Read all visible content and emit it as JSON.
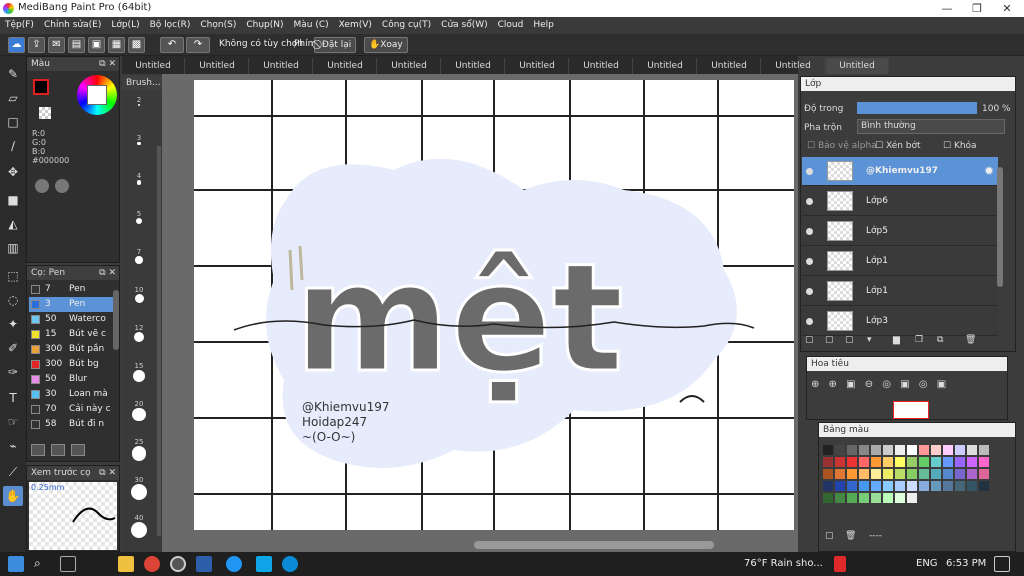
{
  "window": {
    "title": "MediBang Paint Pro (64bit)",
    "min": "—",
    "max": "❐",
    "close": "✕"
  },
  "menu": [
    "Tệp(F)",
    "Chỉnh sửa(E)",
    "Lớp(L)",
    "Bộ lọc(R)",
    "Chọn(S)",
    "Chụp(N)",
    "Màu (C)",
    "Xem(V)",
    "Công cụ(T)",
    "Cửa sổ(W)",
    "Cloud",
    "Help"
  ],
  "toolbar": {
    "no_options": "Không có tùy chọn",
    "key_label": "Phím",
    "reset_label": "Đặt lại",
    "rotate_label": "Xoay"
  },
  "tabs": [
    "Untitled",
    "Untitled",
    "Untitled",
    "Untitled",
    "Untitled",
    "Untitled",
    "Untitled",
    "Untitled",
    "Untitled",
    "Untitled",
    "Untitled",
    "Untitled"
  ],
  "color_panel": {
    "title": "Màu",
    "r": "R:0",
    "g": "G:0",
    "b": "B:0",
    "hex": "#000000"
  },
  "brush_panel": {
    "title": "Cọ: Pen",
    "items": [
      {
        "size": "7",
        "name": "Pen",
        "color": "#333333"
      },
      {
        "size": "3",
        "name": "Pen",
        "color": "#2a6fdc"
      },
      {
        "size": "50",
        "name": "Waterco",
        "color": "#6ec6f0"
      },
      {
        "size": "15",
        "name": "Bút vẽ c",
        "color": "#f2e12a"
      },
      {
        "size": "300",
        "name": "Bút pần",
        "color": "#e9a23b"
      },
      {
        "size": "300",
        "name": "Bút bg",
        "color": "#e02626"
      },
      {
        "size": "50",
        "name": "Blur",
        "color": "#e88ee8"
      },
      {
        "size": "30",
        "name": "Loan mà",
        "color": "#58c0f0"
      },
      {
        "size": "70",
        "name": "Cải này c",
        "color": "#333333"
      },
      {
        "size": "58",
        "name": "Bút đi n",
        "color": "#333333"
      }
    ]
  },
  "preview_panel": {
    "title": "Xem trước cọ",
    "size": "0.25mm"
  },
  "brush_strip": {
    "title": "Brush...",
    "sizes": [
      "2",
      "3",
      "4",
      "5",
      "7",
      "10",
      "12",
      "15",
      "20",
      "25",
      "30",
      "40"
    ]
  },
  "canvas_text": {
    "word": "mệt",
    "credit1": "@Khiemvu197",
    "credit2": "Hoidap247",
    "credit3": "~(O-O~)"
  },
  "layer_panel": {
    "title": "Lớp",
    "opacity_label": "Độ trong",
    "opacity_value": "100 %",
    "opacity_fraction": 1.0,
    "blend_label": "Pha trộn",
    "blend_value": "Bình thường",
    "protect_alpha": "Bảo vệ alpha",
    "clip": "Xén bớt",
    "lock": "Khóa",
    "layers": [
      "@Khiemvu197",
      "Lớp6",
      "Lớp5",
      "Lớp1",
      "Lớp1",
      "Lớp3"
    ]
  },
  "navigator": {
    "title": "Hoa tiêu"
  },
  "palette": {
    "title": "Bảng màu",
    "footer": "----"
  },
  "taskbar": {
    "weather": "76°F  Rain sho...",
    "lang": "ENG",
    "time": "6:53 PM"
  }
}
